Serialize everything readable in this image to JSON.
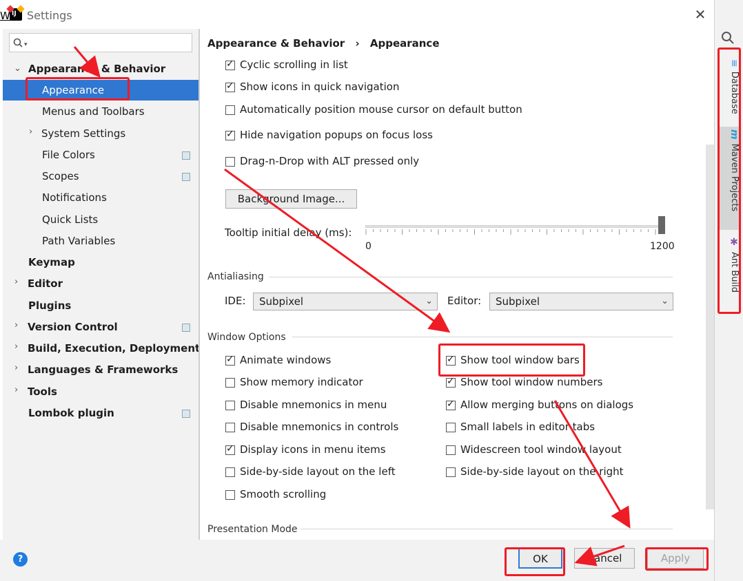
{
  "window": {
    "title": "Settings",
    "stray_text": "W"
  },
  "search": {
    "placeholder": ""
  },
  "tree": {
    "items": [
      {
        "label": "Appearance & Behavior"
      },
      {
        "label": "Appearance"
      },
      {
        "label": "Menus and Toolbars"
      },
      {
        "label": "System Settings"
      },
      {
        "label": "File Colors"
      },
      {
        "label": "Scopes"
      },
      {
        "label": "Notifications"
      },
      {
        "label": "Quick Lists"
      },
      {
        "label": "Path Variables"
      },
      {
        "label": "Keymap"
      },
      {
        "label": "Editor"
      },
      {
        "label": "Plugins"
      },
      {
        "label": "Version Control"
      },
      {
        "label": "Build, Execution, Deployment"
      },
      {
        "label": "Languages & Frameworks"
      },
      {
        "label": "Tools"
      },
      {
        "label": "Lombok plugin"
      }
    ]
  },
  "breadcrumb": {
    "parent": "Appearance & Behavior",
    "sep": "›",
    "current": "Appearance"
  },
  "ui_options": [
    {
      "label": "Cyclic scrolling in list",
      "checked": true
    },
    {
      "label": "Show icons in quick navigation",
      "checked": true
    },
    {
      "label": "Automatically position mouse cursor on default button",
      "checked": false
    },
    {
      "label": "Hide navigation popups on focus loss",
      "checked": true
    },
    {
      "label": "Drag-n-Drop with ALT pressed only",
      "checked": false
    }
  ],
  "background_button": "Background Image...",
  "tooltip": {
    "label": "Tooltip initial delay (ms):",
    "min": "0",
    "max": "1200",
    "value": 1200
  },
  "antialiasing": {
    "title": "Antialiasing",
    "ide_label": "IDE:",
    "ide_value": "Subpixel",
    "editor_label": "Editor:",
    "editor_value": "Subpixel"
  },
  "window_options": {
    "title": "Window Options",
    "left": [
      {
        "label": "Animate windows",
        "checked": true
      },
      {
        "label": "Show memory indicator",
        "checked": false
      },
      {
        "label": "Disable mnemonics in menu",
        "checked": false
      },
      {
        "label": "Disable mnemonics in controls",
        "checked": false
      },
      {
        "label": "Display icons in menu items",
        "checked": true
      },
      {
        "label": "Side-by-side layout on the left",
        "checked": false
      },
      {
        "label": "Smooth scrolling",
        "checked": false
      }
    ],
    "right": [
      {
        "label": "Show tool window bars",
        "checked": true
      },
      {
        "label": "Show tool window numbers",
        "checked": true
      },
      {
        "label": "Allow merging buttons on dialogs",
        "checked": true
      },
      {
        "label": "Small labels in editor tabs",
        "checked": false
      },
      {
        "label": "Widescreen tool window layout",
        "checked": false
      },
      {
        "label": "Side-by-side layout on the right",
        "checked": false
      }
    ]
  },
  "presentation": {
    "title": "Presentation Mode"
  },
  "buttons": {
    "help": "?",
    "ok": "OK",
    "cancel": "Cancel",
    "apply": "Apply"
  },
  "tool_strip": {
    "tabs": [
      {
        "label": "Database",
        "icon": "database-icon"
      },
      {
        "label": "Maven Projects",
        "icon": "maven-icon"
      },
      {
        "label": "Ant Build",
        "icon": "ant-icon"
      }
    ]
  },
  "colors": {
    "selection": "#2f77d1",
    "annotation": "#ee1c25"
  }
}
